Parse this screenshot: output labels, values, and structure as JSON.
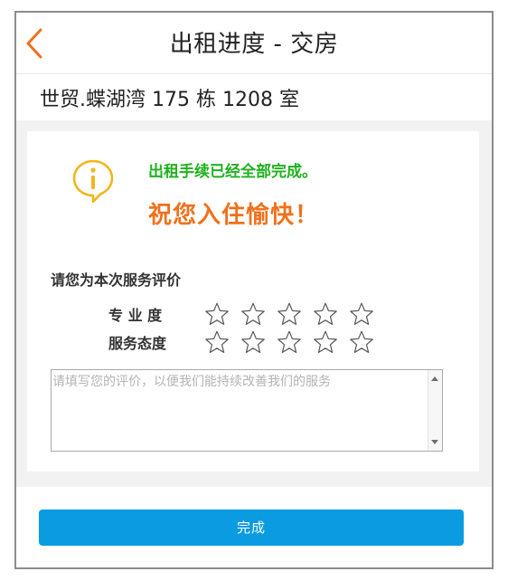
{
  "header": {
    "title": "出租进度 - 交房",
    "back_icon": "chevron-left-icon",
    "accent_color": "#f0711c"
  },
  "property": {
    "address": "世贸.蝶湖湾   175 栋 1208 室"
  },
  "notice": {
    "icon": "info-bubble-icon",
    "message": "出租手续已经全部完成。",
    "message_color": "#1fb21f",
    "greeting": "祝您入住愉快！",
    "greeting_color": "#f0711c"
  },
  "rating": {
    "title": "请您为本次服务评价",
    "rows": [
      {
        "label": "专 业 度",
        "stars_total": 5,
        "stars_filled": 0
      },
      {
        "label": "服务态度",
        "stars_total": 5,
        "stars_filled": 0
      }
    ],
    "comment": {
      "value": "",
      "placeholder": "请填写您的评价，以便我们能持续改善我们的服务"
    }
  },
  "footer": {
    "done_label": "完成",
    "button_color": "#0a9be1"
  }
}
